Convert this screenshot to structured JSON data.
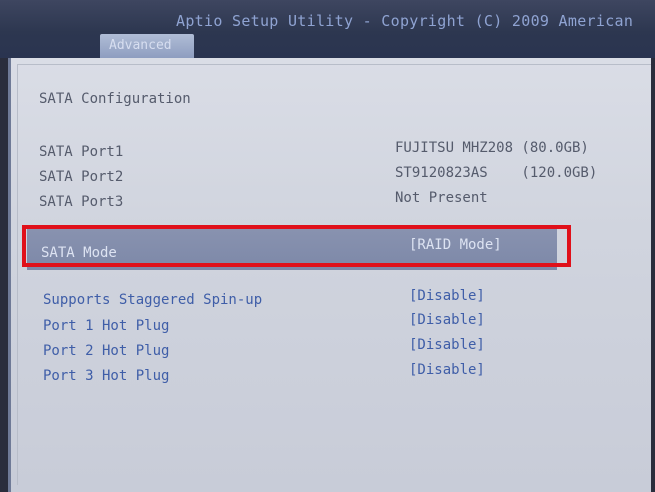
{
  "header": {
    "title": "Aptio Setup Utility - Copyright (C) 2009 American",
    "active_tab": "Advanced"
  },
  "page": {
    "section_title": "SATA Configuration"
  },
  "ports": [
    {
      "label": "SATA Port1",
      "value": "FUJITSU MHZ208 (80.0GB)"
    },
    {
      "label": "SATA Port2",
      "value": "ST9120823AS    (120.0GB)"
    },
    {
      "label": "SATA Port3",
      "value": "Not Present"
    }
  ],
  "selected_option": {
    "label": "SATA Mode",
    "value": "[RAID Mode]",
    "annotation_color": "#e0101a"
  },
  "options": [
    {
      "label": "Supports Staggered Spin-up",
      "value": "[Disable]"
    },
    {
      "label": "Port 1 Hot Plug",
      "value": "[Disable]"
    },
    {
      "label": "Port 2 Hot Plug",
      "value": "[Disable]"
    },
    {
      "label": "Port 3 Hot Plug",
      "value": "[Disable]"
    }
  ],
  "colors": {
    "static_text": "#555b6c",
    "option_text": "#3f5ea8",
    "highlight_bg": "#7d88a8"
  }
}
